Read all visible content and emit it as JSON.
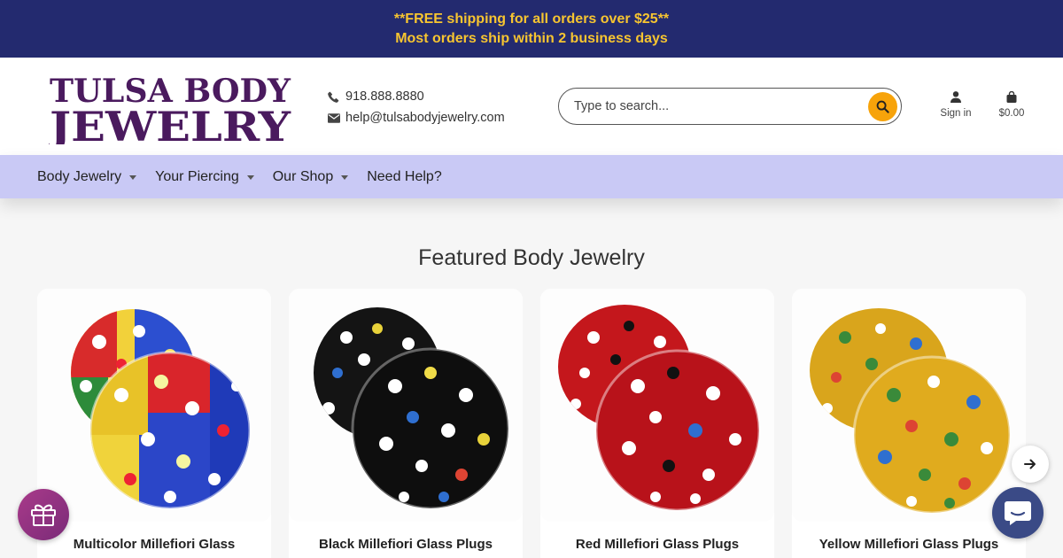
{
  "announcement": {
    "line1": "**FREE shipping for all orders over $25**",
    "line2": "Most orders ship within 2 business days"
  },
  "brand": {
    "logo_line1": "TULSA BODY",
    "logo_line2": "JEWELRY",
    "logo_color": "#4a1a5e"
  },
  "contact": {
    "phone": "918.888.8880",
    "email": "help@tulsabodyjewelry.com"
  },
  "search": {
    "placeholder": "Type to search..."
  },
  "account": {
    "sign_in_label": "Sign in",
    "cart_total": "$0.00"
  },
  "nav": {
    "items": [
      {
        "label": "Body Jewelry",
        "has_dropdown": true
      },
      {
        "label": "Your Piercing",
        "has_dropdown": true
      },
      {
        "label": "Our Shop",
        "has_dropdown": true
      },
      {
        "label": "Need Help?",
        "has_dropdown": false
      }
    ]
  },
  "featured": {
    "title": "Featured Body Jewelry",
    "products": [
      {
        "name": "Multicolor Millefiori Glass",
        "glass_color": "multicolor"
      },
      {
        "name": "Black Millefiori Glass Plugs",
        "glass_color": "black"
      },
      {
        "name": "Red Millefiori Glass Plugs",
        "glass_color": "red"
      },
      {
        "name": "Yellow Millefiori Glass Plugs",
        "glass_color": "yellow"
      }
    ]
  },
  "colors": {
    "announcement_bg": "#232a6f",
    "announcement_text": "#f7c530",
    "nav_bg": "#c9c9f5",
    "search_button": "#f7a30a",
    "gift_button": "#9a3585",
    "chat_button": "#3a4a86"
  },
  "icons": [
    "phone-icon",
    "envelope-icon",
    "search-icon",
    "user-icon",
    "shopping-bag-icon",
    "caret-down-icon",
    "arrow-right-icon",
    "gift-icon",
    "chat-icon"
  ]
}
